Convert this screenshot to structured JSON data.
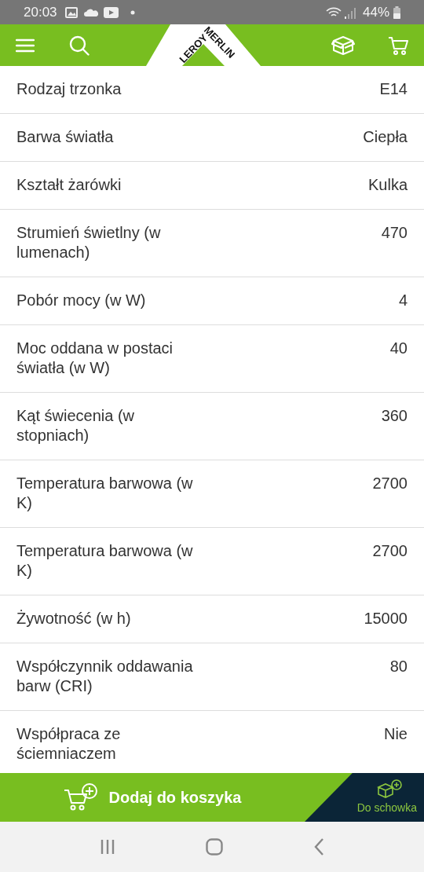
{
  "status_bar": {
    "time": "20:03",
    "battery": "44%"
  },
  "header": {
    "logo": {
      "left": "LEROY",
      "right": "MERLIN"
    }
  },
  "specs": [
    {
      "name": "Rodzaj trzonka",
      "value": "E14"
    },
    {
      "name": "Barwa światła",
      "value": "Ciepła"
    },
    {
      "name": "Kształt żarówki",
      "value": "Kulka"
    },
    {
      "name": "Strumień świetlny (w lumenach)",
      "value": "470"
    },
    {
      "name": "Pobór mocy (w W)",
      "value": "4"
    },
    {
      "name": "Moc oddana w postaci światła (w W)",
      "value": "40"
    },
    {
      "name": "Kąt świecenia (w stopniach)",
      "value": "360"
    },
    {
      "name": "Temperatura barwowa (w K)",
      "value": "2700"
    },
    {
      "name": "Temperatura barwowa (w K)",
      "value": "2700"
    },
    {
      "name": "Żywotność (w h)",
      "value": "15000"
    },
    {
      "name": "Współczynnik oddawania barw (CRI)",
      "value": "80"
    },
    {
      "name": "Współpraca ze ściemniaczem",
      "value": "Nie"
    }
  ],
  "action_bar": {
    "add_to_cart": "Dodaj do koszyka",
    "save": "Do schowka"
  }
}
